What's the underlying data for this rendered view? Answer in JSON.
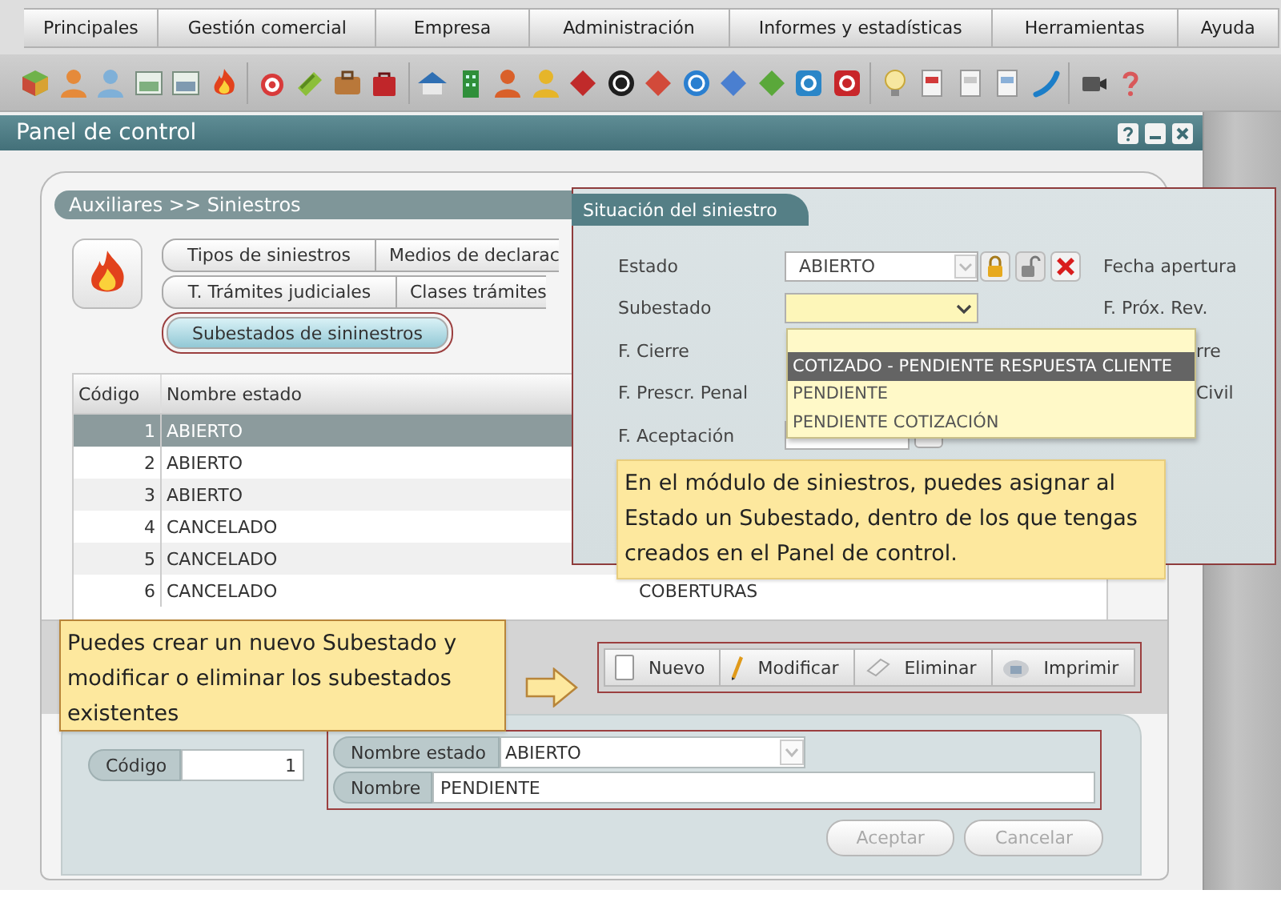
{
  "menu": [
    {
      "label": "Principales"
    },
    {
      "label": "Gestión comercial"
    },
    {
      "label": "Empresa"
    },
    {
      "label": "Administración"
    },
    {
      "label": "Informes y estadísticas"
    },
    {
      "label": "Herramientas"
    },
    {
      "label": "Ayuda"
    }
  ],
  "window": {
    "title": "Panel de control"
  },
  "breadcrumb": "Auxiliares >> Siniestros",
  "section_tabs": [
    [
      {
        "label": "Tipos de siniestros",
        "selected": false
      },
      {
        "label": "Medios de declarac",
        "selected": false
      }
    ],
    [
      {
        "label": "T. Trámites judiciales",
        "selected": false
      },
      {
        "label": "Clases trámites",
        "selected": false
      }
    ],
    [
      {
        "label": "Subestados de sininestros",
        "selected": true
      }
    ]
  ],
  "table": {
    "columns": [
      "Código",
      "Nombre estado"
    ],
    "rows": [
      {
        "code": "1",
        "name": "ABIERTO",
        "selected": true
      },
      {
        "code": "2",
        "name": "ABIERTO",
        "selected": false
      },
      {
        "code": "3",
        "name": "ABIERTO",
        "selected": false
      },
      {
        "code": "4",
        "name": "CANCELADO",
        "selected": false
      },
      {
        "code": "5",
        "name": "CANCELADO",
        "selected": false
      },
      {
        "code": "6",
        "name": "CANCELADO",
        "column_3": "COBERTURAS",
        "selected": false
      }
    ]
  },
  "actions": [
    {
      "label": "Nuevo"
    },
    {
      "label": "Modificar"
    },
    {
      "label": "Eliminar"
    },
    {
      "label": "Imprimir"
    }
  ],
  "form": {
    "code_label": "Código",
    "code": "1",
    "estado_label": "Nombre estado",
    "estado": "ABIERTO",
    "nombre_label": "Nombre",
    "nombre": "PENDIENTE",
    "buttons": [
      {
        "label": "Aceptar",
        "disabled": true
      },
      {
        "label": "Cancelar",
        "disabled": true
      }
    ]
  },
  "situation": {
    "title": "Situación del siniestro",
    "rows": [
      {
        "label": "Estado",
        "value": "ABIERTO",
        "right_label": "Fecha apertura"
      },
      {
        "label": "Subestado",
        "value": "",
        "right_label": "F. Próx. Rev."
      },
      {
        "label": "F. Cierre",
        "right_label": "rre"
      },
      {
        "label": "F. Prescr. Penal",
        "right_label": "Civil"
      },
      {
        "label": "F. Aceptación"
      }
    ],
    "options": [
      {
        "label": "COTIZADO - PENDIENTE RESPUESTA CLIENTE",
        "selected": true
      },
      {
        "label": "PENDIENTE",
        "selected": false
      },
      {
        "label": "PENDIENTE COTIZACIÓN",
        "selected": false
      }
    ]
  },
  "callouts": [
    {
      "text": "En el módulo de siniestros, puedes asignar al Estado un Subestado, dentro de los que tengas creados en el Panel de control."
    },
    {
      "text": "Puedes crear un nuevo Subestado y modificar o eliminar los subestados existentes"
    }
  ]
}
